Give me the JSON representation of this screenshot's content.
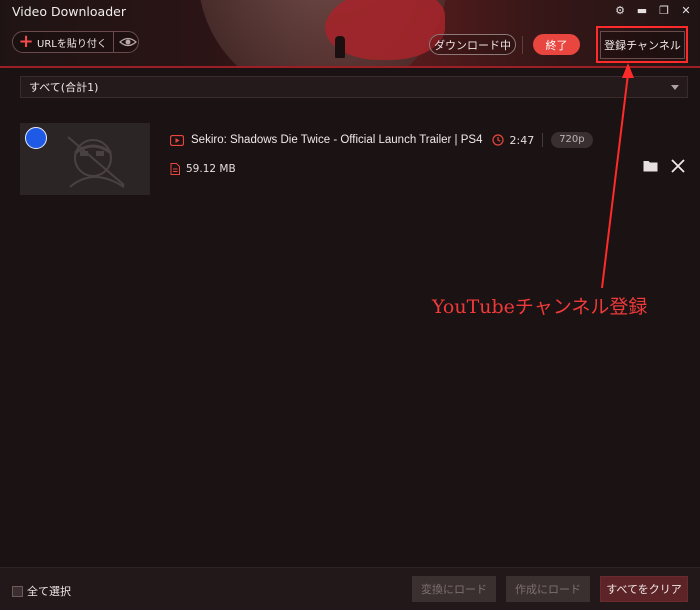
{
  "window": {
    "title": "Video Downloader",
    "controls": {
      "settings": "⚙",
      "minimize": "▬",
      "restore": "❐",
      "close": "✕"
    }
  },
  "header": {
    "paste_url_plus": "+",
    "paste_url_label": "URLを貼り付く",
    "downloading_label": "ダウンロード中",
    "finished_label": "終了",
    "subscribe_label": "登録チャンネル"
  },
  "filter": {
    "selected": "すべて(合計1)"
  },
  "items": [
    {
      "title": "Sekiro: Shadows Die Twice - Official Launch Trailer | PS4",
      "duration": "2:47",
      "quality": "720p",
      "size": "59.12 MB",
      "selected": true
    }
  ],
  "annotation": {
    "text": "YouTubeチャンネル登録"
  },
  "footer": {
    "select_all_label": "全て選択",
    "convert_label": "変換にロード",
    "create_label": "作成にロード",
    "clear_all_label": "すべてをクリア"
  },
  "colors": {
    "accent": "#e8463e",
    "annotation": "#ff2a2a",
    "selection": "#1f5ae6",
    "background": "#1b1213"
  }
}
